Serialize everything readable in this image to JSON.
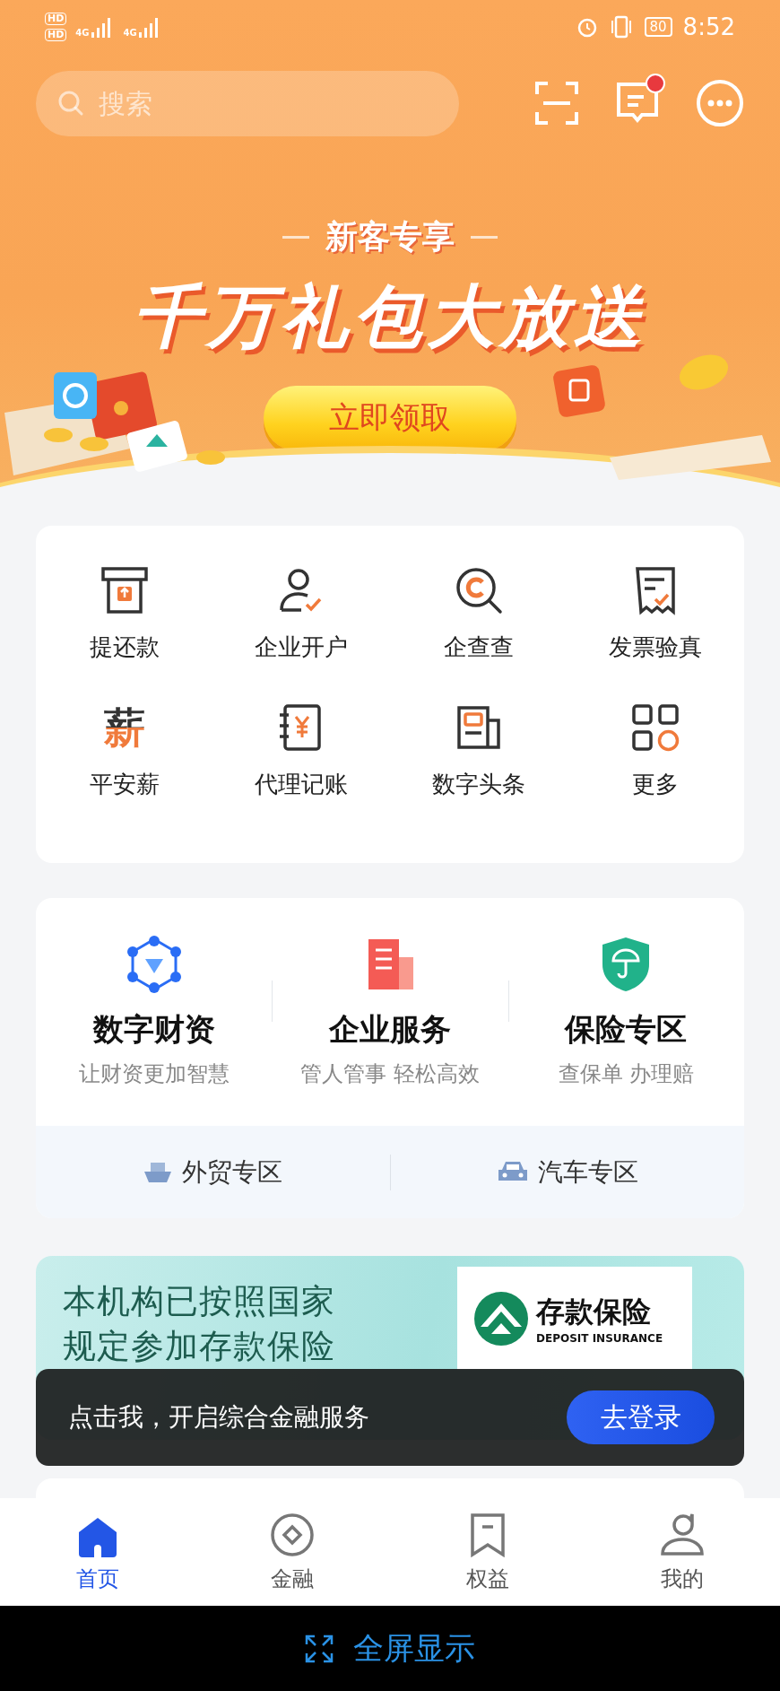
{
  "status_bar": {
    "sim_1": "HD",
    "sim_2": "HD",
    "network_1": "4G",
    "network_2": "4G",
    "battery": "80",
    "time": "8:52"
  },
  "header": {
    "search": {
      "placeholder": "搜索"
    },
    "messages_unread": true
  },
  "promo_banner": {
    "tag": "新客专享",
    "title": "千万礼包大放送",
    "button": "立即领取"
  },
  "quick_actions": [
    {
      "label": "提还款"
    },
    {
      "label": "企业开户"
    },
    {
      "label": "企查查"
    },
    {
      "label": "发票验真"
    },
    {
      "label": "平安薪",
      "icon_glyph": "薪"
    },
    {
      "label": "代理记账"
    },
    {
      "label": "数字头条"
    },
    {
      "label": "更多"
    }
  ],
  "services": [
    {
      "title": "数字财资",
      "subtitle": "让财资更加智慧"
    },
    {
      "title": "企业服务",
      "subtitle": "管人管事 轻松高效"
    },
    {
      "title": "保险专区",
      "subtitle": "查保单 办理赔"
    }
  ],
  "zones": [
    {
      "label": "外贸专区"
    },
    {
      "label": "汽车专区"
    }
  ],
  "deposit_banner": {
    "line_1": "本机构已按照国家",
    "line_2": "规定参加存款保险",
    "logo_title": "存款保险",
    "logo_subtitle": "DEPOSIT INSURANCE"
  },
  "login_prompt": {
    "message": "点击我，开启综合金融服务",
    "button": "去登录"
  },
  "tab_bar": [
    {
      "label": "首页",
      "selected": true
    },
    {
      "label": "金融",
      "selected": false
    },
    {
      "label": "权益",
      "selected": false
    },
    {
      "label": "我的",
      "selected": false
    }
  ],
  "fullscreen_bar": {
    "label": "全屏显示"
  }
}
